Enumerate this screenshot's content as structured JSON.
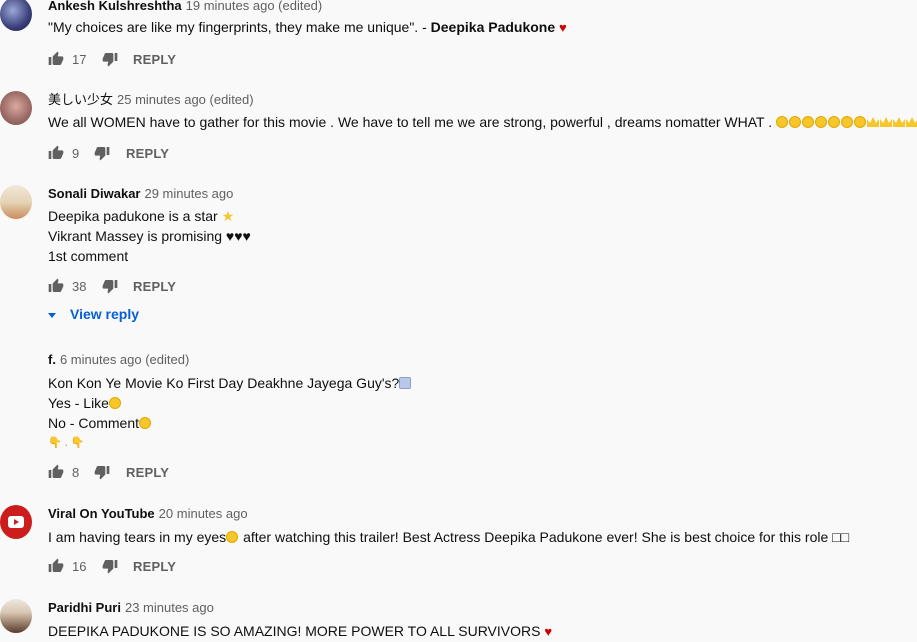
{
  "comments": [
    {
      "author": "Ankesh Kulshreshtha",
      "time": "19 minutes ago (edited)",
      "lines": [
        "\"My choices are like my fingerprints, they make me unique\". - "
      ],
      "bold_suffix": "Deepika Padukone",
      "likes": "17",
      "reply": "REPLY"
    },
    {
      "author": "美しい少女",
      "time": "25 minutes ago (edited)",
      "lines": [
        "We all WOMEN have to gather for this movie . We have to tell me we are strong, powerful , dreams nomatter WHAT ."
      ],
      "likes": "9",
      "reply": "REPLY"
    },
    {
      "author": "Sonali Diwakar",
      "time": "29 minutes ago",
      "lines": [
        "Deepika padukone is a star",
        "Vikrant Massey is promising ♥♥♥",
        "1st comment"
      ],
      "likes": "38",
      "reply": "REPLY",
      "view_reply": "View reply"
    },
    {
      "author": "f.",
      "time": "6 minutes ago (edited)",
      "lines": [
        "Kon Kon Ye Movie Ko First Day Deakhne Jayega Guy's?",
        "Yes - Like",
        "No - Comment",
        "👇 . 👇"
      ],
      "likes": "8",
      "reply": "REPLY"
    },
    {
      "author": "Viral On YouTube",
      "time": "20 minutes ago",
      "lines": [
        "I am having tears in my eyes",
        " after watching this trailer! Best Actress Deepika Padukone ever! She is best choice for this role □□"
      ],
      "likes": "16",
      "reply": "REPLY"
    },
    {
      "author": "Paridhi Puri",
      "time": "23 minutes ago",
      "lines": [
        "DEEPIKA PADUKONE IS SO AMAZING! MORE POWER TO ALL SURVIVORS"
      ]
    }
  ],
  "icons": {
    "like": "thumb-up-icon",
    "dislike": "thumb-down-icon",
    "heart": "heart-icon",
    "star": "star-icon"
  },
  "colors": {
    "link": "#065fd4",
    "meta": "#606060",
    "heart": "#cc0000"
  }
}
